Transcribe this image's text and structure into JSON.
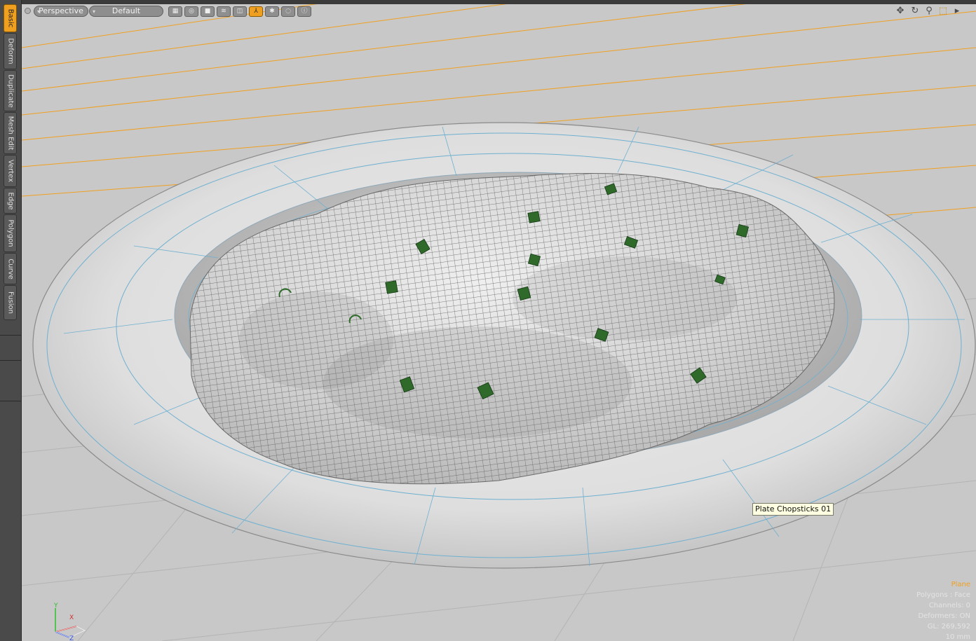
{
  "sidebar": {
    "tabs": [
      {
        "label": "Basic",
        "active": true
      },
      {
        "label": "Deform",
        "active": false
      },
      {
        "label": "Duplicate",
        "active": false
      },
      {
        "label": "Mesh Edit",
        "active": false
      },
      {
        "label": "Vertex",
        "active": false
      },
      {
        "label": "Edge",
        "active": false
      },
      {
        "label": "Polygon",
        "active": false
      },
      {
        "label": "Curve",
        "active": false
      },
      {
        "label": "Fusion",
        "active": false
      }
    ]
  },
  "toolbar": {
    "view_mode": "Perspective",
    "shading_style": "Default",
    "display_toggles": [
      "checker-icon",
      "wire-pattern-icon",
      "cube-icon",
      "mesh-icon",
      "overlay-icon",
      "move-gizmo-icon",
      "vertex-icon",
      "curve-icon"
    ],
    "nav_icons": [
      "pan-icon",
      "rotate-icon",
      "zoom-icon",
      "fit-icon",
      "maximize-icon"
    ]
  },
  "viewport": {
    "tooltip": "Plate Chopsticks 01",
    "info": {
      "selected_item": "Plane",
      "selection_mode": "Polygons : Face",
      "channels": "Channels: 0",
      "deformers": "Deformers: ON",
      "gl_count": "GL: 269,592",
      "grid_size": "10 mm"
    },
    "axis_labels": [
      "Y",
      "X",
      "Z"
    ],
    "grid_line_color": "#f0a020",
    "accent_color": "#f0a020"
  }
}
